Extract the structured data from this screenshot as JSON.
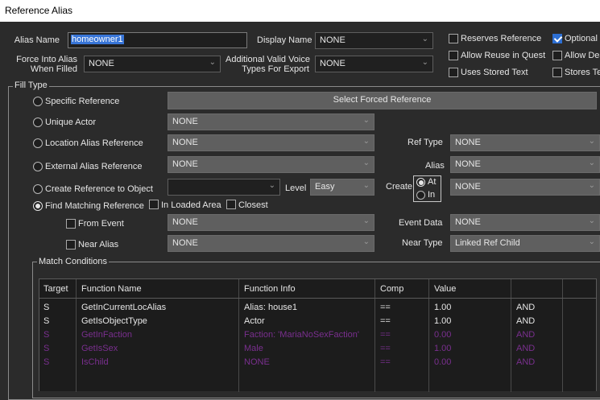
{
  "window": {
    "title": "Reference Alias"
  },
  "top": {
    "alias_name_label": "Alias Name",
    "alias_name_value": "homeowner1",
    "display_name_label": "Display Name",
    "display_name_value": "NONE",
    "force_into_alias_label_1": "Force Into Alias",
    "force_into_alias_label_2": "When Filled",
    "force_into_alias_value": "NONE",
    "voice_types_label_1": "Additional Valid Voice",
    "voice_types_label_2": "Types For Export",
    "voice_types_value": "NONE",
    "checks": {
      "reserves_reference": "Reserves Reference",
      "allow_reuse_in_quest": "Allow Reuse in Quest",
      "uses_stored_text": "Uses Stored Text",
      "optional": "Optional",
      "allow_dead": "Allow Dea",
      "stores_text": "Stores Te"
    }
  },
  "fill_type": {
    "caption": "Fill Type",
    "specific_reference": "Specific Reference",
    "select_forced_reference": "Select Forced Reference",
    "unique_actor": "Unique Actor",
    "unique_actor_value": "NONE",
    "location_alias_reference": "Location Alias Reference",
    "location_alias_value": "NONE",
    "ref_type_label": "Ref Type",
    "ref_type_value": "NONE",
    "external_alias_reference": "External Alias Reference",
    "external_alias_value": "NONE",
    "alias_label": "Alias",
    "alias_value": "NONE",
    "create_reference_to_object": "Create Reference to Object",
    "create_object_value": "",
    "level_label": "Level",
    "level_value": "Easy",
    "create_label": "Create",
    "create_at": "At",
    "create_in": "In",
    "create_value": "NONE",
    "find_matching_reference": "Find Matching Reference",
    "in_loaded_area": "In Loaded Area",
    "closest": "Closest",
    "from_event": "From Event",
    "from_event_value": "NONE",
    "event_data_label": "Event Data",
    "event_data_value": "NONE",
    "near_alias": "Near Alias",
    "near_alias_value": "NONE",
    "near_type_label": "Near Type",
    "near_type_value": "Linked Ref Child"
  },
  "match_conditions": {
    "caption": "Match Conditions",
    "columns": [
      "Target",
      "Function Name",
      "Function Info",
      "Comp",
      "Value",
      "",
      ""
    ],
    "rows": [
      {
        "target": "S",
        "function_name": "GetInCurrentLocAlias",
        "function_info": "Alias: house1",
        "comp": "==",
        "value": "1.00",
        "op": "AND",
        "dim": false
      },
      {
        "target": "S",
        "function_name": "GetIsObjectType",
        "function_info": "Actor",
        "comp": "==",
        "value": "1.00",
        "op": "AND",
        "dim": false
      },
      {
        "target": "S",
        "function_name": "GetInFaction",
        "function_info": "Faction: 'MariaNoSexFaction'",
        "comp": "==",
        "value": "0.00",
        "op": "AND",
        "dim": true
      },
      {
        "target": "S",
        "function_name": "GetIsSex",
        "function_info": "Male",
        "comp": "==",
        "value": "1.00",
        "op": "AND",
        "dim": true
      },
      {
        "target": "S",
        "function_name": "IsChild",
        "function_info": "NONE",
        "comp": "==",
        "value": "0.00",
        "op": "AND",
        "dim": true
      }
    ]
  },
  "colors": {
    "accent": "#2d6fd3",
    "dim_row": "#7a2f8f",
    "background": "#2b2b2b"
  }
}
